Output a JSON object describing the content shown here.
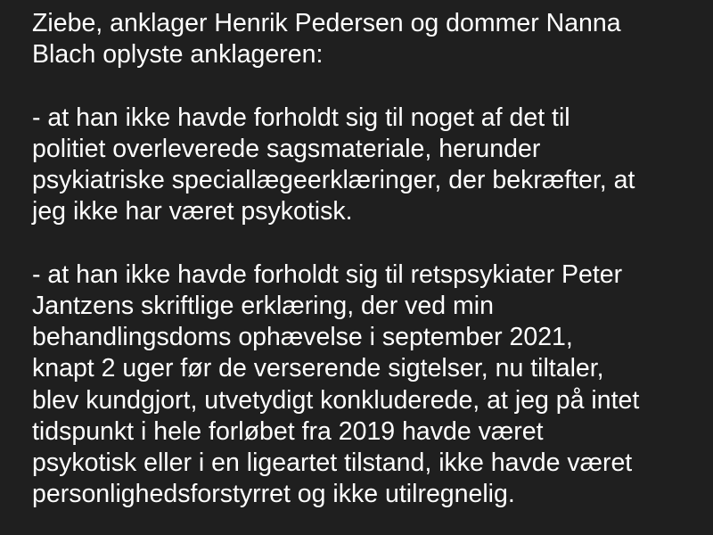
{
  "message": {
    "intro_lines": [
      "Ziebe, anklager Henrik Pedersen og dommer Nanna",
      "Blach oplyste anklageren:"
    ],
    "paragraph_1_lines": [
      "- at han ikke havde forholdt sig til noget af det til",
      "politiet overleverede sagsmateriale, herunder",
      "psykiatriske speciallægeerklæringer, der bekræfter, at",
      "jeg ikke har været psykotisk."
    ],
    "paragraph_2_lines": [
      "- at han ikke havde forholdt sig til retspsykiater Peter",
      "Jantzens skriftlige erklæring, der ved min",
      "behandlingsdoms ophævelse i september 2021,",
      "knapt 2 uger før de verserende sigtelser, nu tiltaler,",
      "blev kundgjort, utvetydigt konkluderede, at jeg på intet",
      "tidspunkt i hele forløbet fra 2019 havde været",
      "psykotisk eller i en ligeartet tilstand, ikke havde været",
      "personlighedsforstyrret og ikke utilregnelig."
    ]
  }
}
